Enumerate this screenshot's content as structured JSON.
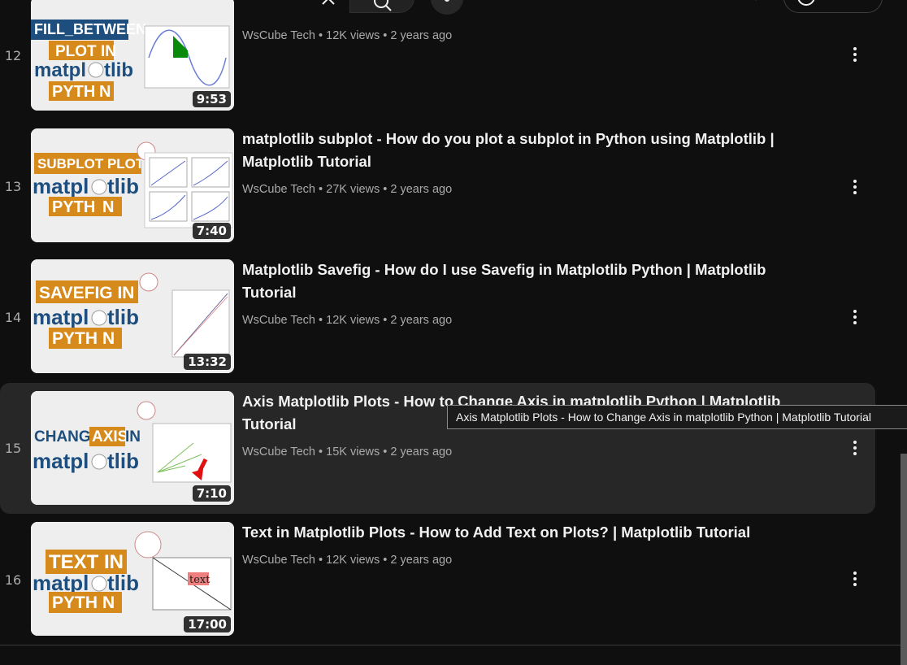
{
  "topbar": {
    "clear_icon": "close-icon",
    "search_icon": "search-icon",
    "mic_icon": "mic-icon",
    "caret_icon": "chevron-down-icon",
    "signin_icon": "account-circle-icon"
  },
  "videos": [
    {
      "index": "12",
      "title": "",
      "channel": "WsCube Tech",
      "views": "12K views",
      "age": "2 years ago",
      "duration": "9:53",
      "thumb_text": [
        "FILL_BETWEEN",
        "PLOT IN",
        "matpl",
        "tlib",
        "PYTH",
        "N"
      ]
    },
    {
      "index": "13",
      "title": "matplotlib subplot - How do you plot a subplot in Python using Matplotlib | Matplotlib Tutorial",
      "channel": "WsCube Tech",
      "views": "27K views",
      "age": "2 years ago",
      "duration": "7:40",
      "thumb_text": [
        "SUBPLOT PLOT IN",
        "matpl",
        "tlib",
        "PYTH",
        "N"
      ]
    },
    {
      "index": "14",
      "title": "Matplotlib Savefig - How do I use Savefig in Matplotlib Python | Matplotlib Tutorial",
      "channel": "WsCube Tech",
      "views": "12K views",
      "age": "2 years ago",
      "duration": "13:32",
      "thumb_text": [
        "SAVEFIG IN",
        "matpl",
        "tlib",
        "PYTH",
        "N"
      ]
    },
    {
      "index": "15",
      "title": "Axis Matplotlib Plots - How to Change Axis in matplotlib Python | Matplotlib Tutorial",
      "channel": "WsCube Tech",
      "views": "15K views",
      "age": "2 years ago",
      "duration": "7:10",
      "thumb_text": [
        "CHANGE",
        "AXIS",
        "IN",
        "matpl",
        "tlib"
      ]
    },
    {
      "index": "16",
      "title": "Text in Matplotlib Plots - How to Add Text on Plots? | Matplotlib Tutorial",
      "channel": "WsCube Tech",
      "views": "12K views",
      "age": "2 years ago",
      "duration": "17:00",
      "thumb_text": [
        "TEXT IN",
        "matpl",
        "tlib",
        "PYTH",
        "N",
        "text"
      ]
    }
  ],
  "tooltip": "Axis Matplotlib Plots - How to Change Axis in matplotlib Python | Matplotlib Tutorial",
  "colors": {
    "background": "#0f0f0f",
    "hover_row": "#272727",
    "brand_orange": "#d68a1c",
    "brand_blue": "#1d4e7e"
  }
}
